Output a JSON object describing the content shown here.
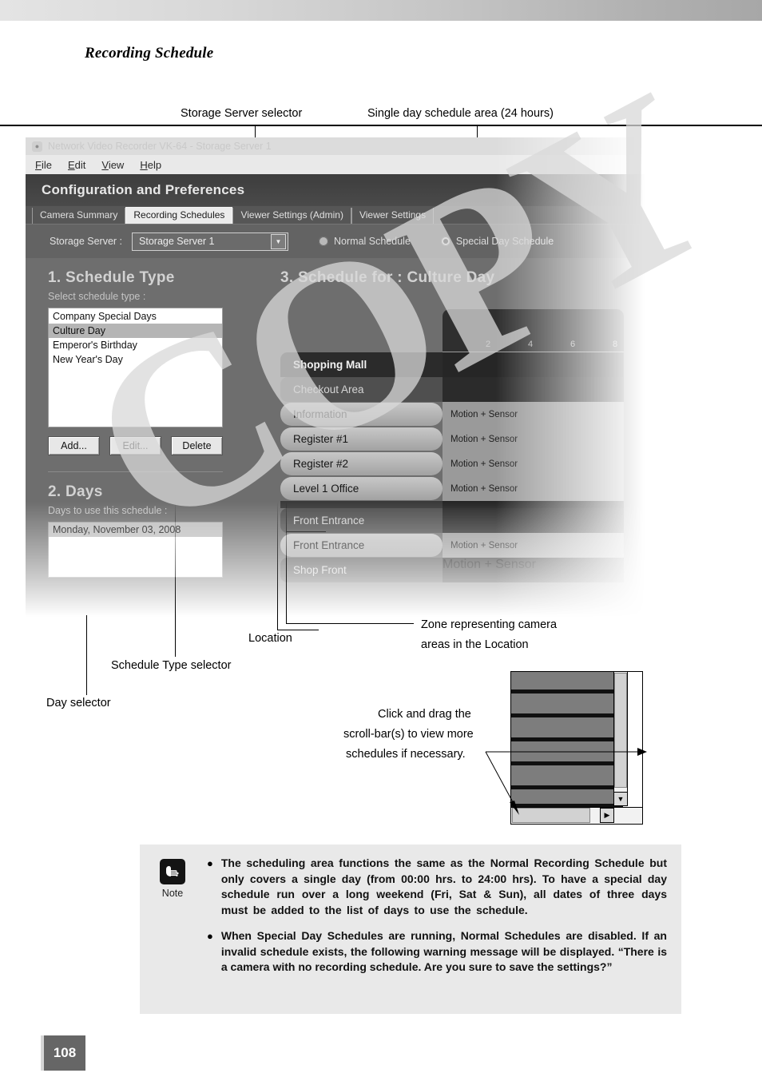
{
  "page": {
    "chapter_title": "Recording Schedule",
    "page_number": "108",
    "watermark": "COPY"
  },
  "callouts": {
    "storage_server_selector": "Storage Server selector",
    "single_day_schedule_area": "Single day schedule area (24 hours)",
    "zone_representing": "Zone representing camera",
    "zone_representing2": "areas in the Location",
    "location": "Location",
    "schedule_type_selector": "Schedule Type selector",
    "day_selector": "Day selector",
    "scrollbar_1": "Click and drag the",
    "scrollbar_2": "scroll-bar(s) to view more",
    "scrollbar_3": "schedules if necessary."
  },
  "app": {
    "titlebar": "Network Video Recorder VK-64 - Storage Server 1",
    "titlebar_icon": "app-icon",
    "menus": [
      "File",
      "Edit",
      "View",
      "Help"
    ],
    "header": "Configuration and Preferences",
    "tabs": [
      {
        "label": "Camera Summary",
        "active": false
      },
      {
        "label": "Recording Schedules",
        "active": true
      },
      {
        "label": "Viewer Settings (Admin)",
        "active": false
      },
      {
        "label": "Viewer Settings",
        "active": false
      }
    ],
    "toolbar": {
      "storage_server_label": "Storage Server :",
      "storage_server_value": "Storage Server 1",
      "dropdown_arrow": "▼",
      "radio_normal": "Normal Schedule",
      "radio_special": "Special Day Schedule",
      "selected_radio": "Special Day Schedule"
    },
    "schedule_type": {
      "title": "1. Schedule Type",
      "subtitle": "Select schedule type :",
      "items": [
        {
          "label": "Company Special Days",
          "selected": false
        },
        {
          "label": "Culture Day",
          "selected": true
        },
        {
          "label": "Emperor's Birthday",
          "selected": false
        },
        {
          "label": "New Year's Day",
          "selected": false
        }
      ],
      "buttons": [
        "Add...",
        "Edit...",
        "Delete"
      ]
    },
    "days": {
      "title": "2. Days",
      "subtitle": "Days to use this schedule :",
      "items": [
        "Monday, November 03, 2008"
      ]
    },
    "schedule": {
      "title": "3. Schedule for : Culture Day",
      "time_ticks": [
        "2",
        "4",
        "6",
        "8"
      ],
      "rows": [
        {
          "type": "loc",
          "name": "Shopping Mall",
          "mode": ""
        },
        {
          "type": "zone",
          "name": "Checkout Area",
          "mode": ""
        },
        {
          "type": "cam",
          "name": "Information",
          "mode": "Motion + Sensor"
        },
        {
          "type": "cam",
          "name": "Register #1",
          "mode": "Motion + Sensor"
        },
        {
          "type": "cam",
          "name": "Register #2",
          "mode": "Motion + Sensor"
        },
        {
          "type": "cam",
          "name": "Level 1 Office",
          "mode": "Motion + Sensor"
        },
        {
          "type": "gap",
          "name": "",
          "mode": ""
        },
        {
          "type": "zone",
          "name": "Front Entrance",
          "mode": ""
        },
        {
          "type": "cam",
          "name": "Front Entrance",
          "mode": "Motion + Sensor"
        },
        {
          "type": "zone",
          "name": "Shop Front",
          "mode": "Motion + Sensor"
        }
      ]
    }
  },
  "note": {
    "label": "Note",
    "icon": "pointing-hand-icon",
    "bullet": "●",
    "items": [
      "The scheduling area functions the same as the Normal Recording Schedule but only covers a single day (from 00:00 hrs. to 24:00 hrs). To have a special day schedule run over a long weekend (Fri, Sat & Sun), all dates of three days must be added to the list of days to use the schedule.",
      "When Special Day Schedules are running, Normal Schedules are disabled. If an invalid schedule exists, the following warning message will be displayed. “There is a camera with no recording schedule. Are you sure to save the settings?”"
    ]
  },
  "inset": {
    "vertical_down_arrow": "▼",
    "horizontal_right_arrow": "▶"
  }
}
